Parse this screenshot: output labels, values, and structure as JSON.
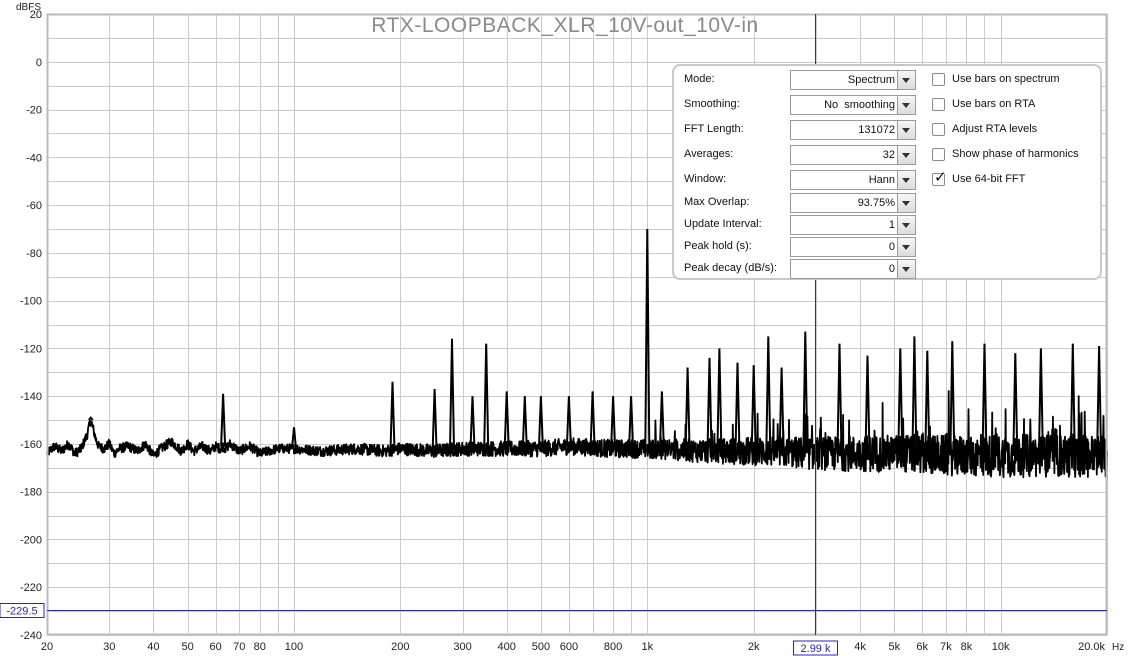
{
  "chart_data": {
    "type": "line",
    "title": "RTX-LOOPBACK_XLR_10V-out_10V-in",
    "ylabel": "dBFS",
    "xlabel_unit": "Hz",
    "x_scale": "log",
    "xlim": [
      20,
      20000
    ],
    "ylim": [
      -240,
      20
    ],
    "grid": true,
    "y_ticks": [
      20,
      0,
      -20,
      -40,
      -60,
      -80,
      -100,
      -120,
      -140,
      -160,
      -180,
      -200,
      -220,
      -240
    ],
    "x_ticks": [
      {
        "value": 20,
        "label": "20"
      },
      {
        "value": 30,
        "label": "30"
      },
      {
        "value": 40,
        "label": "40"
      },
      {
        "value": 50,
        "label": "50"
      },
      {
        "value": 60,
        "label": "60"
      },
      {
        "value": 70,
        "label": "70"
      },
      {
        "value": 80,
        "label": "80"
      },
      {
        "value": 100,
        "label": "100"
      },
      {
        "value": 200,
        "label": "200"
      },
      {
        "value": 300,
        "label": "300"
      },
      {
        "value": 400,
        "label": "400"
      },
      {
        "value": 500,
        "label": "500"
      },
      {
        "value": 600,
        "label": "600"
      },
      {
        "value": 800,
        "label": "800"
      },
      {
        "value": 1000,
        "label": "1k"
      },
      {
        "value": 2000,
        "label": "2k"
      },
      {
        "value": 4000,
        "label": "4k"
      },
      {
        "value": 5000,
        "label": "5k"
      },
      {
        "value": 6000,
        "label": "6k"
      },
      {
        "value": 7000,
        "label": "7k"
      },
      {
        "value": 8000,
        "label": "8k"
      },
      {
        "value": 10000,
        "label": "10k"
      },
      {
        "value": 20000,
        "label": "20.0k"
      }
    ],
    "noise_floor": [
      [
        20,
        -164
      ],
      [
        21,
        -161
      ],
      [
        22,
        -163
      ],
      [
        23,
        -160
      ],
      [
        24,
        -164
      ],
      [
        25,
        -162
      ],
      [
        26,
        -156
      ],
      [
        26.6,
        -150
      ],
      [
        27.5,
        -158
      ],
      [
        28,
        -161
      ],
      [
        29,
        -162
      ],
      [
        30,
        -160
      ],
      [
        31,
        -164
      ],
      [
        32,
        -162
      ],
      [
        34,
        -161
      ],
      [
        36,
        -163
      ],
      [
        38,
        -160
      ],
      [
        40,
        -165
      ],
      [
        42,
        -162
      ],
      [
        45,
        -159
      ],
      [
        48,
        -163
      ],
      [
        50,
        -160
      ],
      [
        52,
        -163
      ],
      [
        55,
        -161
      ],
      [
        58,
        -163
      ],
      [
        60,
        -161
      ],
      [
        62,
        -162
      ],
      [
        63,
        -161
      ],
      [
        64,
        -162
      ],
      [
        66,
        -160
      ],
      [
        70,
        -163
      ],
      [
        75,
        -161
      ],
      [
        80,
        -164
      ],
      [
        90,
        -162
      ],
      [
        100,
        -162
      ],
      [
        120,
        -163
      ],
      [
        150,
        -162
      ],
      [
        180,
        -163
      ],
      [
        200,
        -162
      ],
      [
        250,
        -163
      ],
      [
        300,
        -162
      ],
      [
        400,
        -162
      ],
      [
        500,
        -162
      ],
      [
        600,
        -161
      ],
      [
        800,
        -162
      ],
      [
        1000,
        -162
      ],
      [
        1500,
        -163
      ],
      [
        2000,
        -163
      ],
      [
        3000,
        -164
      ],
      [
        5000,
        -164
      ],
      [
        8000,
        -165
      ],
      [
        12000,
        -165
      ],
      [
        20000,
        -165
      ]
    ],
    "noise_spread": {
      "x": [
        20,
        100,
        300,
        1000,
        2000,
        3000,
        5000,
        10000,
        20000
      ],
      "amplitude_db": [
        2,
        2,
        3,
        4,
        6,
        7,
        8,
        9,
        9
      ]
    },
    "peaks": [
      {
        "x": 26.6,
        "y": -149
      },
      {
        "x": 63,
        "y": -139
      },
      {
        "x": 100,
        "y": -153
      },
      {
        "x": 190,
        "y": -134
      },
      {
        "x": 250,
        "y": -137
      },
      {
        "x": 280,
        "y": -116
      },
      {
        "x": 320,
        "y": -140
      },
      {
        "x": 350,
        "y": -118
      },
      {
        "x": 400,
        "y": -138
      },
      {
        "x": 450,
        "y": -140
      },
      {
        "x": 500,
        "y": -140
      },
      {
        "x": 600,
        "y": -140
      },
      {
        "x": 700,
        "y": -138
      },
      {
        "x": 800,
        "y": -140
      },
      {
        "x": 900,
        "y": -140
      },
      {
        "x": 1000,
        "y": -70
      },
      {
        "x": 1100,
        "y": -138
      },
      {
        "x": 1300,
        "y": -128
      },
      {
        "x": 1500,
        "y": -124
      },
      {
        "x": 1600,
        "y": -120
      },
      {
        "x": 1800,
        "y": -126
      },
      {
        "x": 2000,
        "y": -127
      },
      {
        "x": 2200,
        "y": -115
      },
      {
        "x": 2400,
        "y": -128
      },
      {
        "x": 2800,
        "y": -113
      },
      {
        "x": 3500,
        "y": -118
      },
      {
        "x": 4200,
        "y": -123
      },
      {
        "x": 5200,
        "y": -120
      },
      {
        "x": 5700,
        "y": -115
      },
      {
        "x": 6200,
        "y": -121
      },
      {
        "x": 7300,
        "y": -117
      },
      {
        "x": 9000,
        "y": -118
      },
      {
        "x": 11000,
        "y": -122
      },
      {
        "x": 13000,
        "y": -120
      },
      {
        "x": 16000,
        "y": -118
      },
      {
        "x": 19000,
        "y": -119
      }
    ],
    "cursor": {
      "x": 2990,
      "x_label": "2.99 k",
      "y": -229.5,
      "y_label": "-229.5",
      "color": "#2a2aa8"
    },
    "colors": {
      "trace": "#000000",
      "grid": "#cccccc",
      "cursor": "#2a2aa8",
      "title": "#8a8a8a"
    }
  },
  "controls": {
    "selects": [
      {
        "label": "Mode:",
        "value": "Spectrum"
      },
      {
        "label": "Smoothing:",
        "value": "No  smoothing"
      },
      {
        "label": "FFT Length:",
        "value": "131072"
      },
      {
        "label": "Averages:",
        "value": "32"
      },
      {
        "label": "Window:",
        "value": "Hann"
      },
      {
        "label": "Max Overlap:",
        "value": "93.75%"
      },
      {
        "label": "Update Interval:",
        "value": "1"
      },
      {
        "label": "Peak hold (s):",
        "value": "0"
      },
      {
        "label": "Peak decay (dB/s):",
        "value": "0"
      }
    ],
    "checkboxes": [
      {
        "label": "Use bars on spectrum",
        "checked": false
      },
      {
        "label": "Use bars on RTA",
        "checked": false
      },
      {
        "label": "Adjust RTA levels",
        "checked": false
      },
      {
        "label": "Show phase of harmonics",
        "checked": false
      },
      {
        "label": "Use 64-bit FFT",
        "checked": true
      }
    ]
  }
}
